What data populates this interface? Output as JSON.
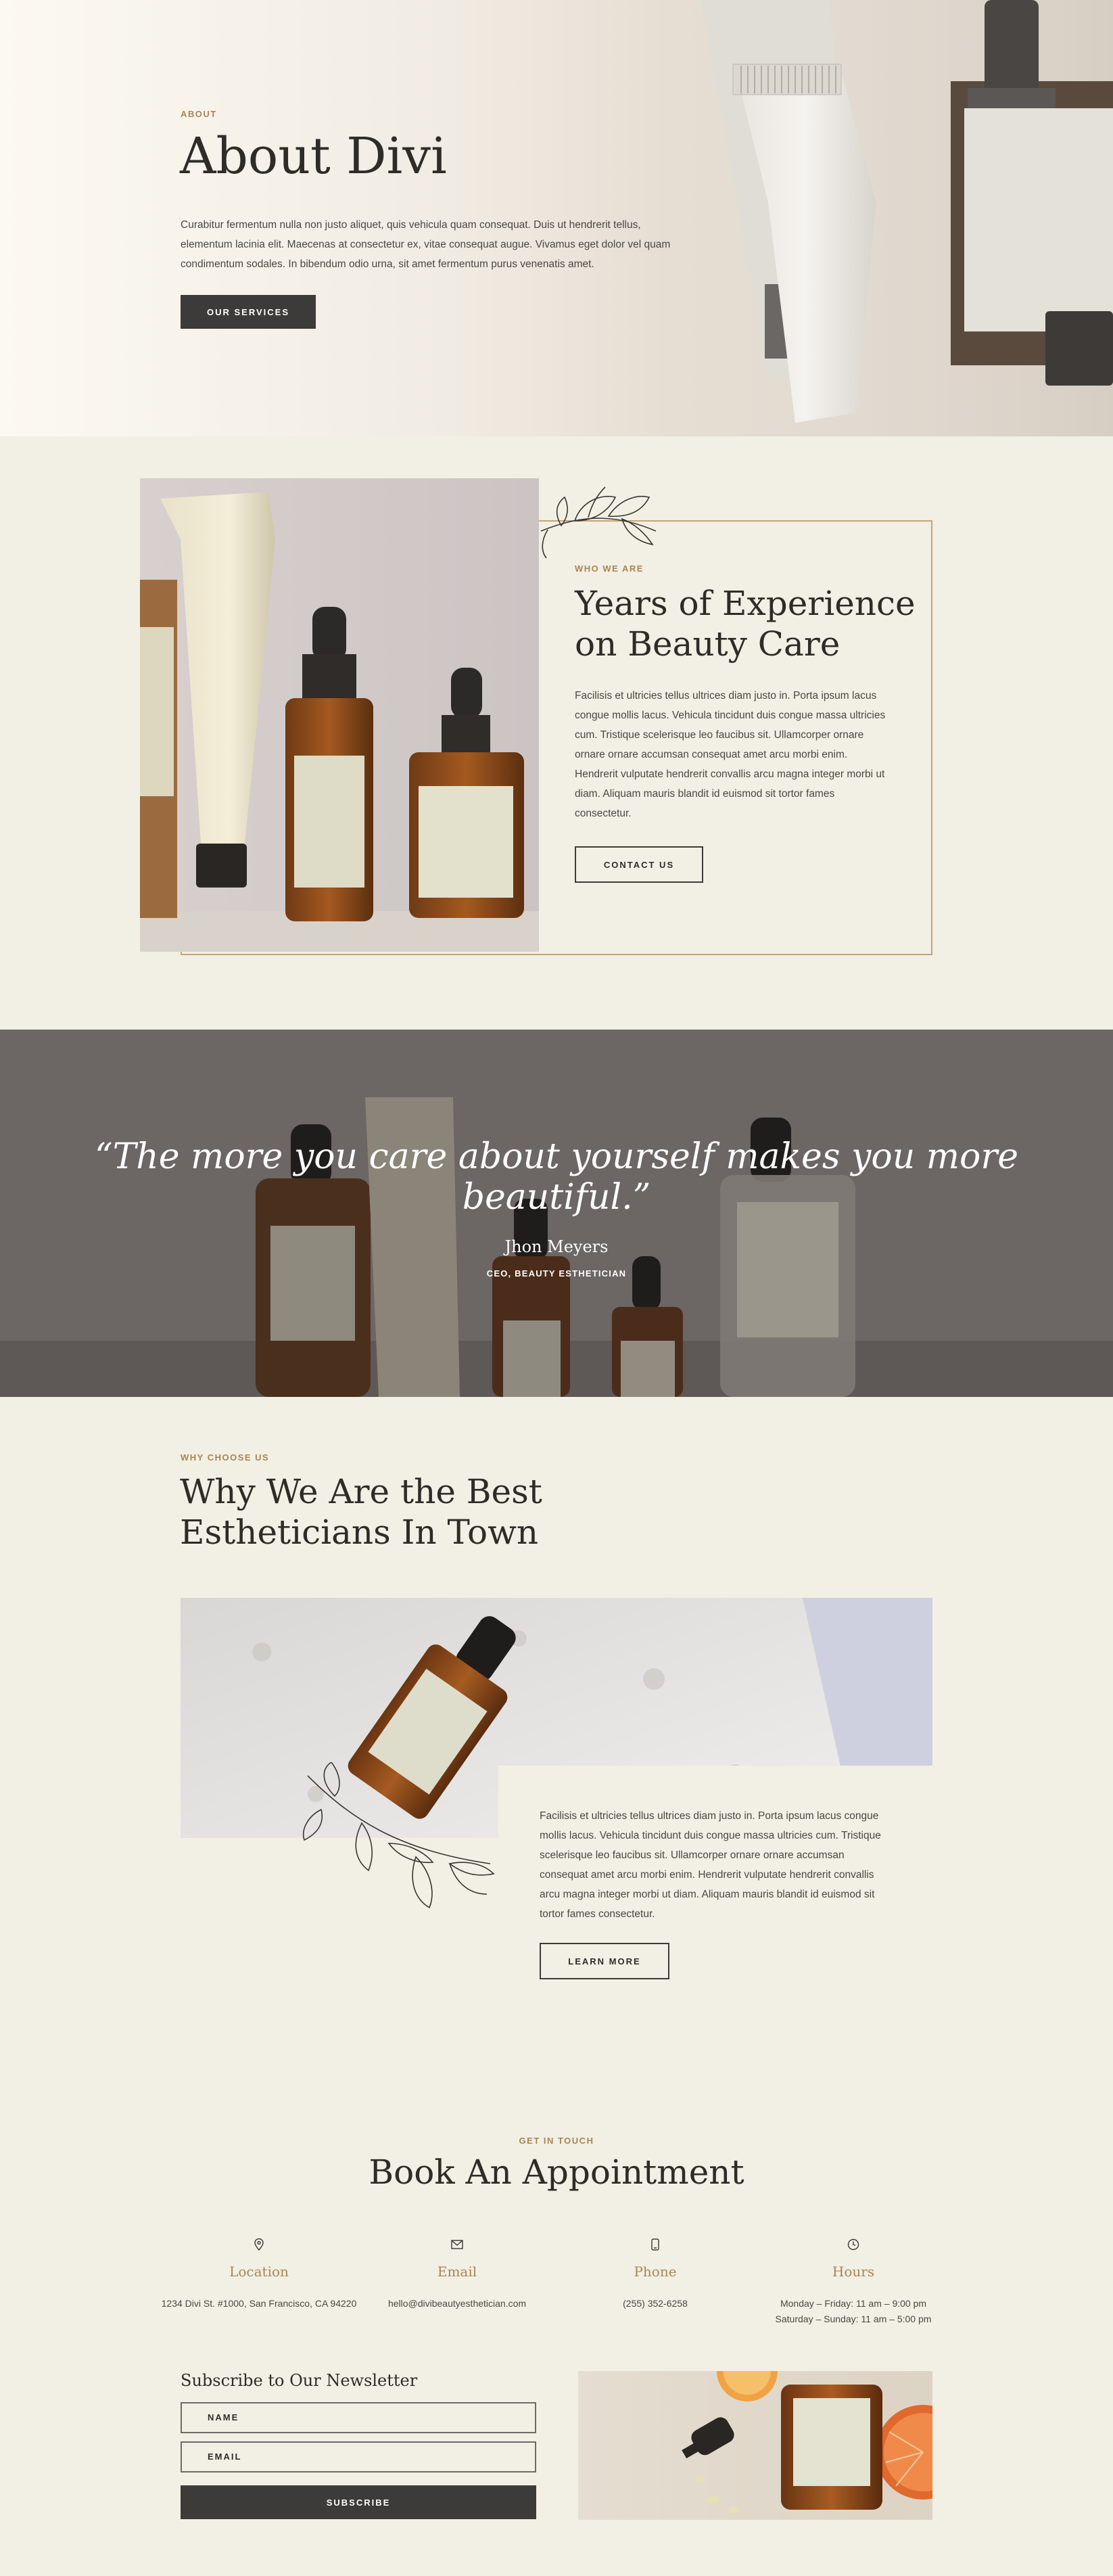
{
  "hero": {
    "eyebrow": "ABOUT",
    "title": "About Divi",
    "text": "Curabitur fermentum nulla non justo aliquet, quis vehicula quam consequat. Duis ut hendrerit tellus, elementum lacinia elit. Maecenas at consectetur ex, vitae consequat augue. Vivamus eget dolor vel quam condimentum sodales. In bibendum odio urna, sit amet fermentum purus venenatis amet.",
    "button": "OUR SERVICES"
  },
  "years": {
    "eyebrow": "WHO WE ARE",
    "title": "Years of Experience on Beauty Care",
    "text": "Facilisis et ultricies tellus ultrices diam justo in. Porta ipsum lacus congue mollis lacus. Vehicula tincidunt duis congue massa ultricies cum. Tristique scelerisque leo faucibus sit. Ullamcorper ornare ornare ornare accumsan consequat amet arcu morbi enim. Hendrerit vulputate hendrerit convallis arcu magna integer morbi ut diam. Aliquam mauris blandit id euismod sit tortor fames consectetur.",
    "button": "CONTACT US"
  },
  "quote": {
    "text": "“The more you care about yourself makes you more beautiful.”",
    "author": "Jhon Meyers",
    "role": "CEO, BEAUTY ESTHETICIAN"
  },
  "why": {
    "eyebrow": "WHY CHOOSE US",
    "title": "Why We Are the Best Estheticians In Town",
    "text": "Facilisis et ultricies tellus ultrices diam justo in. Porta ipsum lacus congue mollis lacus. Vehicula tincidunt duis congue massa ultricies cum. Tristique scelerisque leo faucibus sit. Ullamcorper ornare ornare accumsan consequat amet arcu morbi enim. Hendrerit vulputate hendrerit convallis arcu magna integer morbi ut diam. Aliquam mauris blandit id euismod sit tortor fames consectetur.",
    "button": "LEARN MORE"
  },
  "appointment": {
    "eyebrow": "GET IN TOUCH",
    "title": "Book An Appointment",
    "location": {
      "label": "Location",
      "value": "1234 Divi St. #1000, San Francisco, CA 94220",
      "icon": "map-pin-icon"
    },
    "email": {
      "label": "Email",
      "value": "hello@divibeautyesthetician.com",
      "icon": "envelope-icon"
    },
    "phone": {
      "label": "Phone",
      "value": "(255) 352-6258",
      "icon": "phone-icon"
    },
    "hours": {
      "label": "Hours",
      "line1": "Monday – Friday: 11 am – 9:00 pm",
      "line2": "Saturday – Sunday: 11 am – 5:00 pm",
      "icon": "clock-icon"
    }
  },
  "newsletter": {
    "title": "Subscribe to Our Newsletter",
    "name_placeholder": "NAME",
    "email_placeholder": "EMAIL",
    "button": "SUBSCRIBE"
  },
  "colors": {
    "background": "#f2efe4",
    "accent": "#a88552",
    "button": "#3c3b3a",
    "frame": "#c4a577"
  }
}
